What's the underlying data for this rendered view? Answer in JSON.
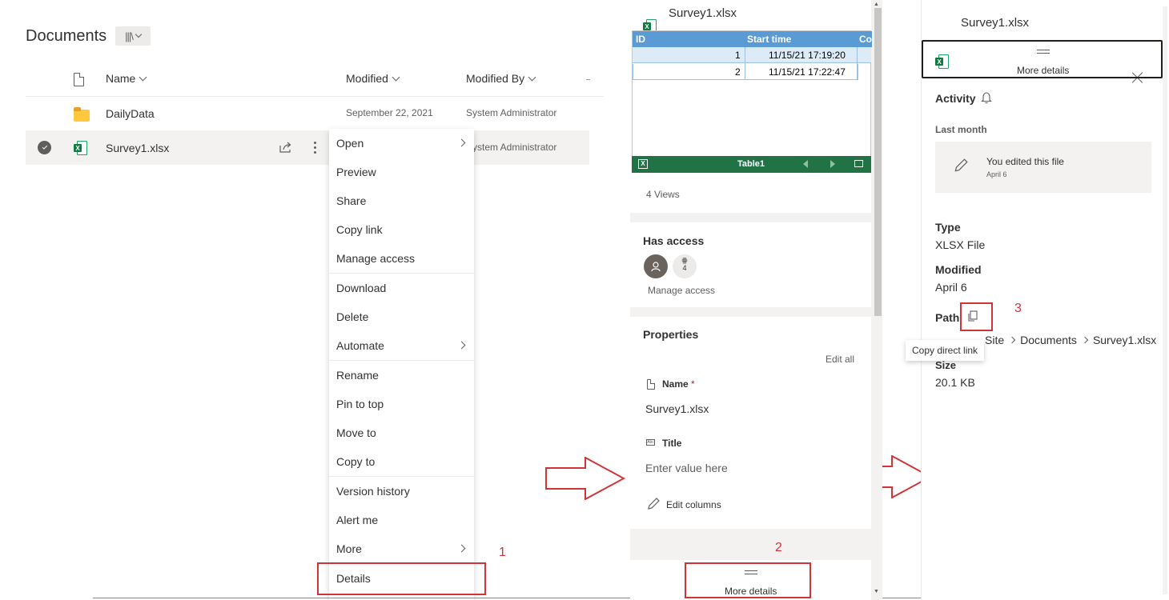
{
  "library": {
    "title": "Documents",
    "columns": {
      "name": "Name",
      "modified": "Modified",
      "modified_by": "Modified By"
    },
    "rows": [
      {
        "name": "DailyData",
        "modified": "September 22, 2021",
        "modified_by": "System Administrator",
        "type": "folder"
      },
      {
        "name": "Survey1.xlsx",
        "modified_by": "System Administrator",
        "type": "xlsx",
        "selected": true
      }
    ]
  },
  "context_menu": {
    "items": [
      "Open",
      "Preview",
      "Share",
      "Copy link",
      "Manage access",
      "Download",
      "Delete",
      "Automate",
      "Rename",
      "Pin to top",
      "Move to",
      "Copy to",
      "Version history",
      "Alert me",
      "More",
      "Details"
    ]
  },
  "steps": {
    "one": "1",
    "two": "2",
    "three": "3"
  },
  "details_panel": {
    "file_name": "Survey1.xlsx",
    "preview": {
      "headers": [
        "ID",
        "Start time",
        "Co"
      ],
      "rows": [
        [
          "1",
          "11/15/21 17:19:20"
        ],
        [
          "2",
          "11/15/21 17:22:47"
        ]
      ],
      "sheet_name": "Table1"
    },
    "views": "4 Views",
    "has_access": {
      "title": "Has access",
      "count": "4",
      "manage": "Manage access"
    },
    "properties": {
      "title": "Properties",
      "edit_all": "Edit all",
      "name_label": "Name",
      "required_mark": "*",
      "name_value": "Survey1.xlsx",
      "title_label": "Title",
      "title_placeholder": "Enter value here",
      "edit_columns": "Edit columns"
    },
    "more_details": "More details"
  },
  "more_details_panel": {
    "file_name": "Survey1.xlsx",
    "more_details": "More details",
    "activity": "Activity",
    "last_month": "Last month",
    "activity_item": {
      "text": "You edited this file",
      "date": "April 6"
    },
    "type_label": "Type",
    "type_value": "XLSX File",
    "modified_label": "Modified",
    "modified_value": "April 6",
    "path_label": "Path",
    "path_segments": [
      "Site",
      "Documents",
      "Survey1.xlsx"
    ],
    "tooltip": "Copy direct link",
    "size_label": "Size",
    "size_value": "20.1 KB"
  },
  "colors": {
    "accent_red": "#d13438",
    "excel_green": "#217346",
    "header_blue": "#5b9bd5"
  }
}
